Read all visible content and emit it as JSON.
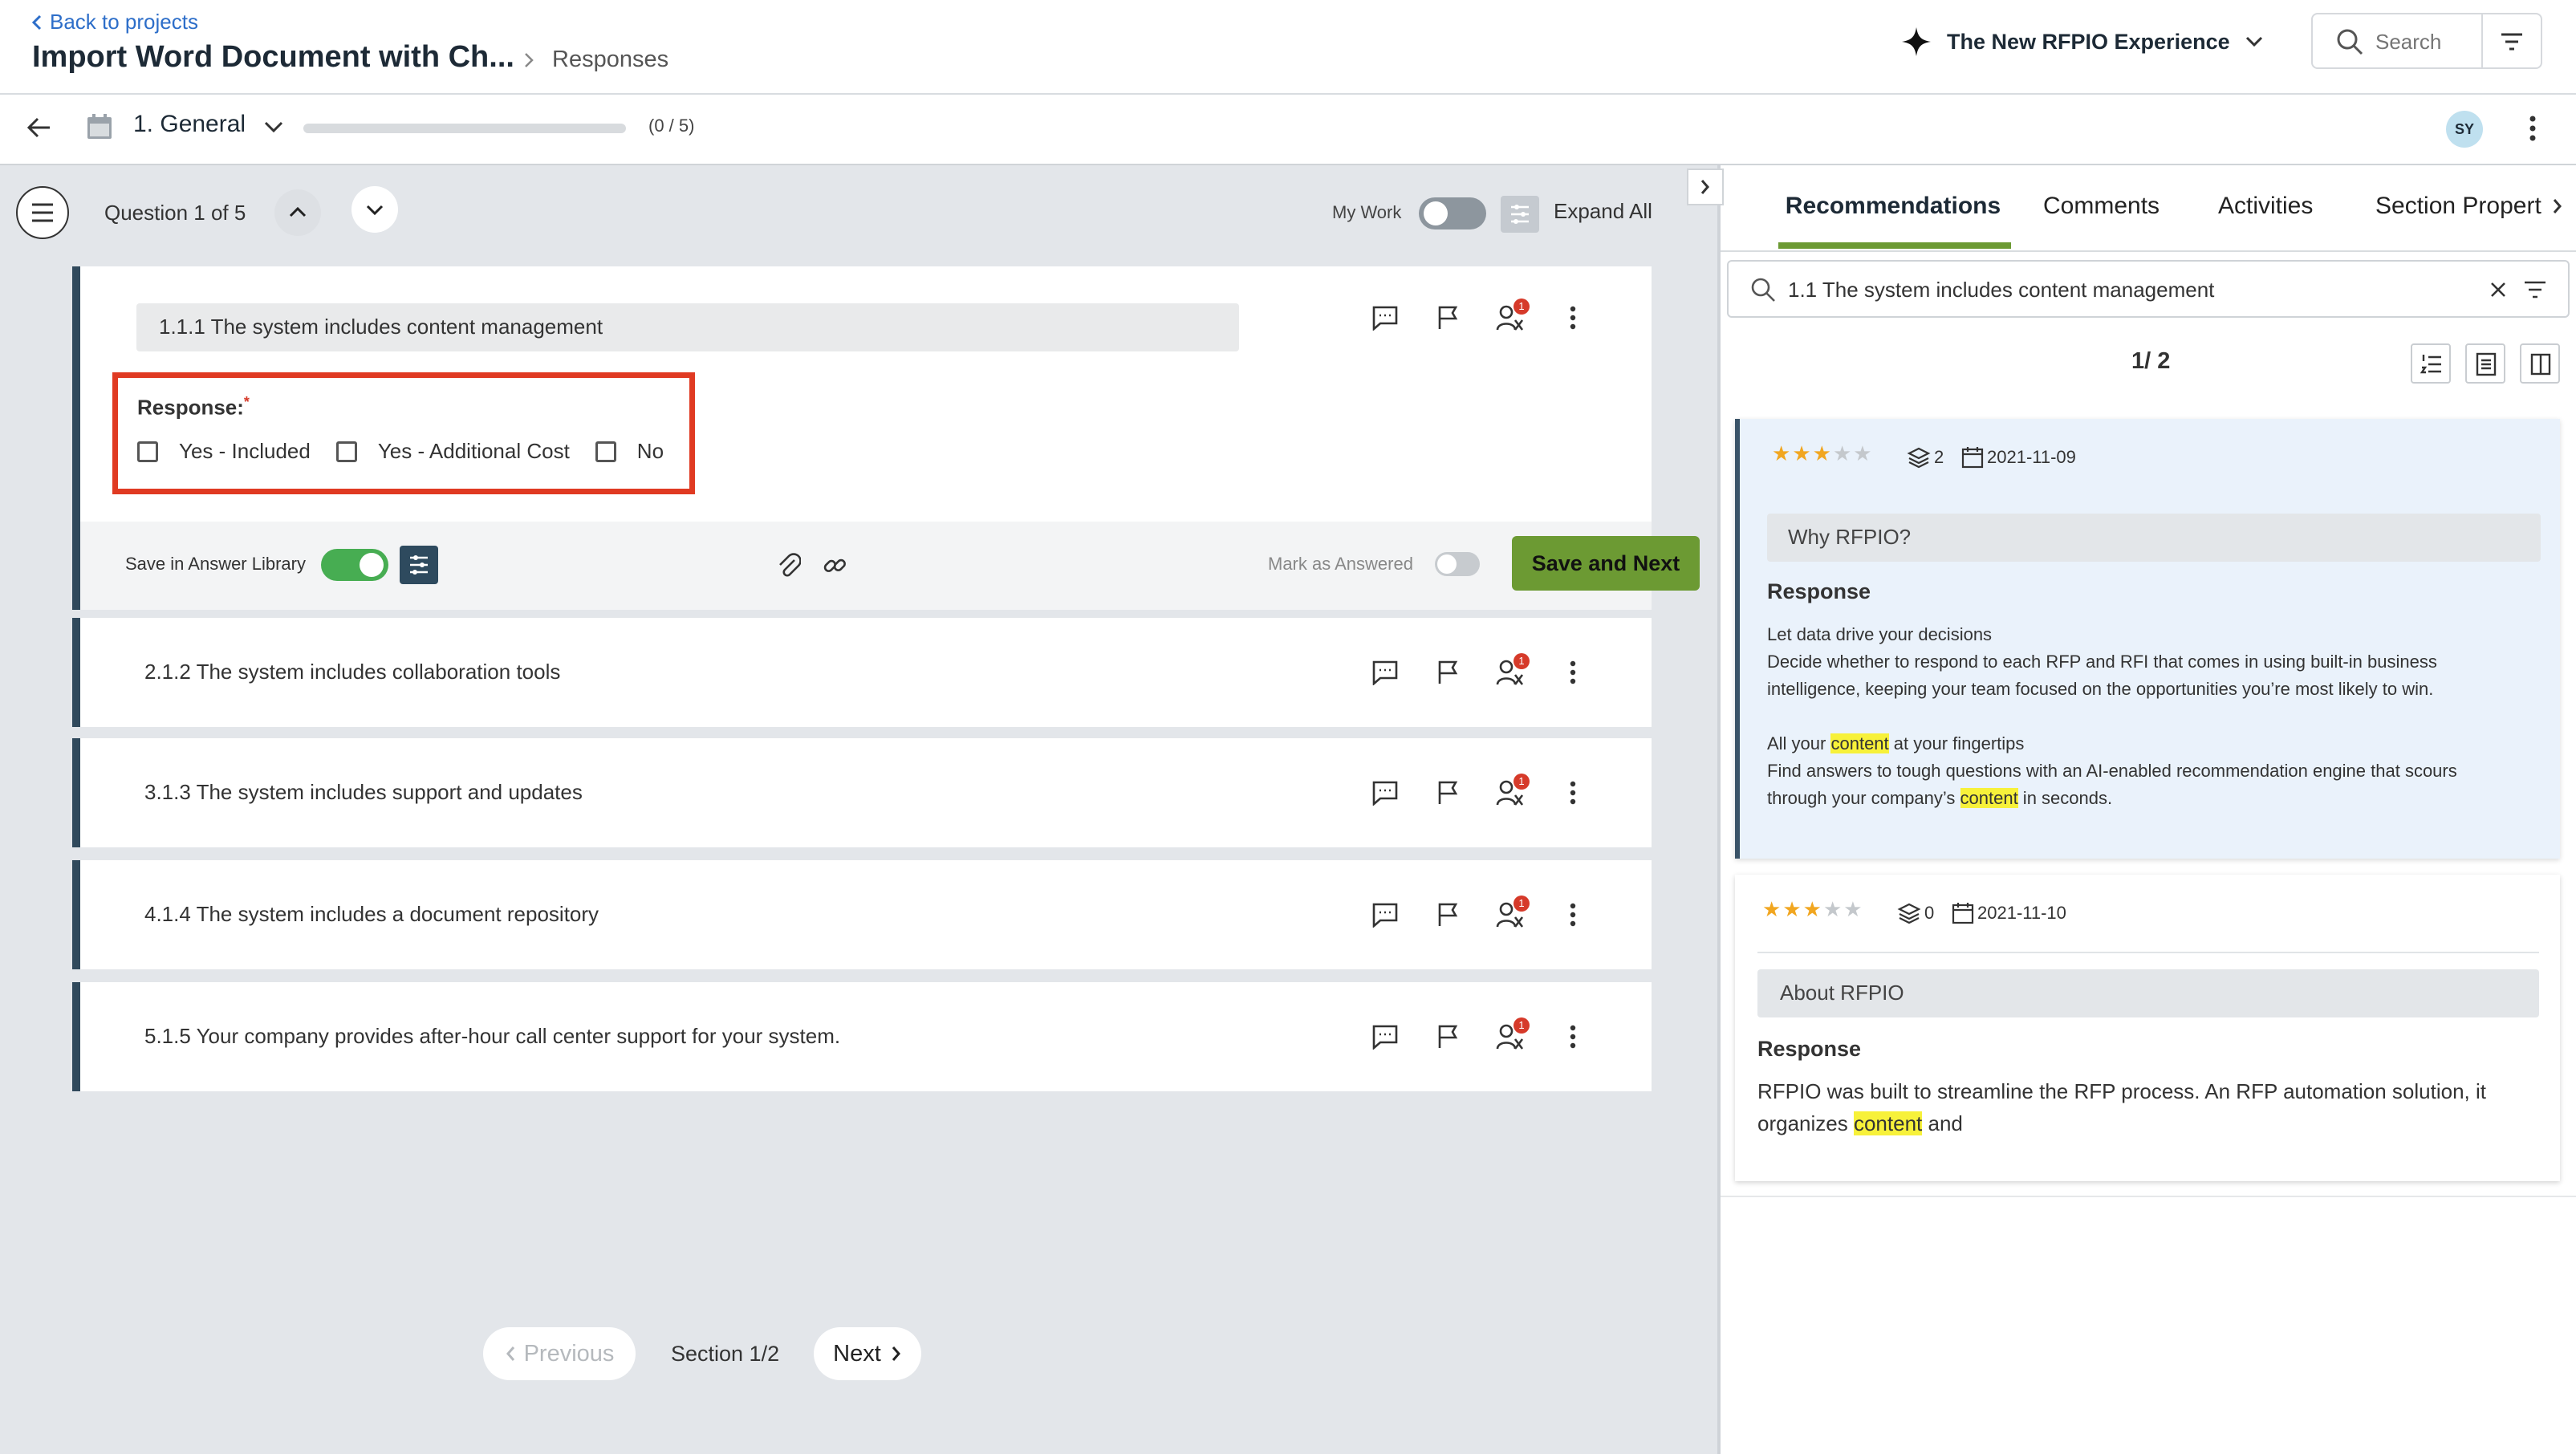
{
  "header": {
    "back_label": "Back to projects",
    "project_title": "Import Word Document with Ch...",
    "breadcrumb_current": "Responses",
    "experience_label": "The New RFPIO Experience",
    "search_placeholder": "Search"
  },
  "subbar": {
    "section_name": "1. General",
    "progress_text": "(0 / 5)",
    "progress_fraction": 0,
    "avatar_initials": "SY"
  },
  "toolbar": {
    "question_counter": "Question 1 of 5",
    "my_work_label": "My Work",
    "expand_all_label": "Expand All"
  },
  "active_question": {
    "title": "1.1.1 The system includes content management",
    "response_label": "Response:",
    "required_mark": "*",
    "options": [
      "Yes - Included",
      "Yes - Additional Cost",
      "No"
    ],
    "save_library_label": "Save in Answer Library",
    "mark_answered_label": "Mark as Answered",
    "save_next_label": "Save and Next"
  },
  "questions": [
    {
      "title": "2.1.2 The system includes collaboration tools",
      "badge": "1"
    },
    {
      "title": "3.1.3 The system includes support and updates",
      "badge": "1"
    },
    {
      "title": "4.1.4 The system includes a document repository",
      "badge": "1"
    },
    {
      "title": "5.1.5 Your company provides after-hour call center support for your system.",
      "badge": "1"
    }
  ],
  "assign_badge": "1",
  "pagination": {
    "previous_label": "Previous",
    "section_label": "Section 1/2",
    "next_label": "Next"
  },
  "right_panel": {
    "tabs": [
      "Recommendations",
      "Comments",
      "Activities",
      "Section Propert"
    ],
    "active_tab": "Recommendations",
    "search_value": "1.1 The system includes content management",
    "result_counter": "1/ 2",
    "results": [
      {
        "rating": 3,
        "rating_max": 5,
        "usage_count": "2",
        "date": "2021-11-09",
        "question": "Why RFPIO?",
        "response_label": "Response",
        "line1": "Let data drive your decisions",
        "line2": "Decide whether to respond to each RFP and RFI that comes in using built-in business intelligence, keeping your team focused on the opportunities you’re most likely to win.",
        "line3_pre": "All your ",
        "highlight_word": "content",
        "line3_post": " at your fingertips",
        "line4": "Find answers to tough questions with an AI-enabled recommendation engine that scours through your company’s ",
        "line4_post": " in seconds."
      },
      {
        "rating": 3,
        "rating_max": 5,
        "usage_count": "0",
        "date": "2021-11-10",
        "question": "About RFPIO",
        "response_label": "Response",
        "text_pre": "RFPIO was built to streamline the RFP process. An RFP automation solution, it organizes ",
        "highlight_word": "content",
        "text_post": " and"
      }
    ]
  },
  "colors": {
    "accent_green": "#6c9a33",
    "toggle_green": "#47ad52",
    "highlight": "#f7f13a",
    "card_border": "#30495c",
    "error_red": "#d63a2a",
    "star": "#f1a620"
  }
}
